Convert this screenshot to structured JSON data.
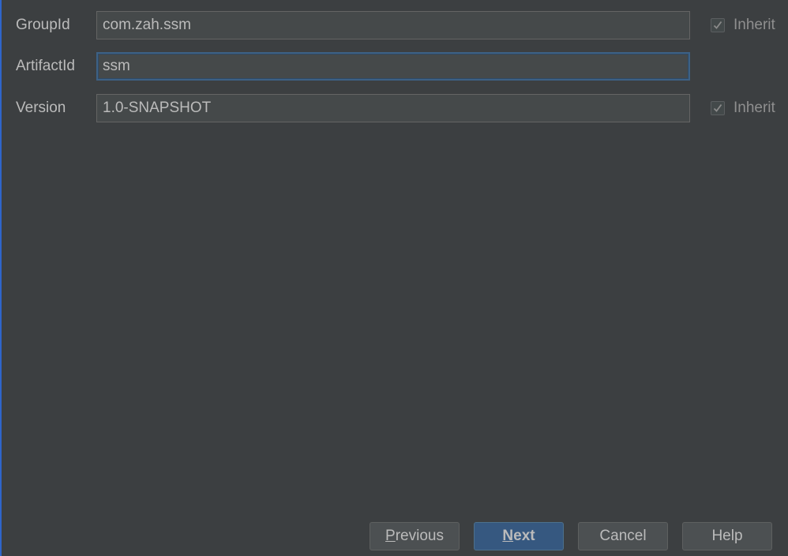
{
  "form": {
    "group_id": {
      "label": "GroupId",
      "value": "com.zah.ssm",
      "inherit_label": "Inherit",
      "inherit_checked": true
    },
    "artifact_id": {
      "label": "ArtifactId",
      "value": "ssm"
    },
    "version": {
      "label": "Version",
      "value": "1.0-SNAPSHOT",
      "inherit_label": "Inherit",
      "inherit_checked": true
    }
  },
  "buttons": {
    "previous": {
      "mnemonic": "P",
      "rest": "revious"
    },
    "next": {
      "mnemonic": "N",
      "rest": "ext"
    },
    "cancel": "Cancel",
    "help": "Help"
  },
  "colors": {
    "background": "#3c3f41",
    "field_background": "#45494a",
    "focus_border": "#3d6185",
    "primary_button": "#365880",
    "text": "#bbbbbb"
  }
}
